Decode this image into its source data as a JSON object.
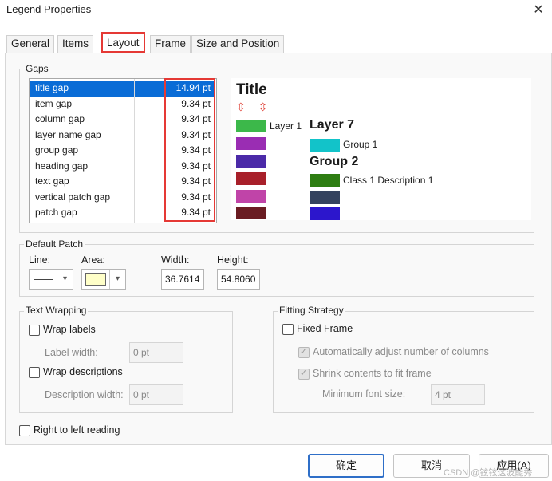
{
  "window": {
    "title": "Legend Properties",
    "close_glyph": "✕"
  },
  "tabs": [
    {
      "label": "General"
    },
    {
      "label": "Items"
    },
    {
      "label": "Layout"
    },
    {
      "label": "Frame"
    },
    {
      "label": "Size and Position"
    }
  ],
  "active_tab": "Layout",
  "gaps": {
    "label": "Gaps",
    "rows": [
      {
        "name": "title gap",
        "value": "14.94 pt",
        "selected": true
      },
      {
        "name": "item gap",
        "value": "9.34 pt"
      },
      {
        "name": "column gap",
        "value": "9.34 pt"
      },
      {
        "name": "layer name gap",
        "value": "9.34 pt"
      },
      {
        "name": "group gap",
        "value": "9.34 pt"
      },
      {
        "name": "heading gap",
        "value": "9.34 pt"
      },
      {
        "name": "text gap",
        "value": "9.34 pt"
      },
      {
        "name": "vertical patch gap",
        "value": "9.34 pt"
      },
      {
        "name": "patch gap",
        "value": "9.34 pt"
      }
    ]
  },
  "preview": {
    "title": "Title",
    "gap_arrows": "⇳ ⇳",
    "layer1_label": "Layer 1",
    "layer7_label": "Layer 7",
    "group1_label": "Group 1",
    "group2_label": "Group 2",
    "class_label": "Class 1 Description 1",
    "colors": {
      "green": "#3cb84a",
      "purple": "#9a2db3",
      "indigo": "#4b2aa8",
      "crimson": "#a8202a",
      "magenta": "#c044a8",
      "maroon": "#6a1c22",
      "cyan": "#12c3c9",
      "darkgreen": "#2e7d12",
      "slate": "#34425e",
      "blue": "#2c16cc",
      "arrow": "#e0463c"
    }
  },
  "default_patch": {
    "label": "Default Patch",
    "line_label": "Line:",
    "area_label": "Area:",
    "width_label": "Width:",
    "height_label": "Height:",
    "width_value": "36.7614",
    "height_value": "54.8060",
    "area_color": "#ffffc8",
    "dropdown_icon": "▾"
  },
  "text_wrapping": {
    "label": "Text Wrapping",
    "wrap_labels": "Wrap labels",
    "label_width_label": "Label width:",
    "label_width_value": "0 pt",
    "wrap_descriptions": "Wrap descriptions",
    "description_width_label": "Description width:",
    "description_width_value": "0 pt"
  },
  "fitting_strategy": {
    "label": "Fitting Strategy",
    "fixed_frame": "Fixed Frame",
    "auto_adjust": "Automatically adjust number of columns",
    "shrink": "Shrink contents to fit frame",
    "min_font_label": "Minimum font size:",
    "min_font_value": "4 pt"
  },
  "right_to_left": "Right to left reading",
  "buttons": {
    "ok": "确定",
    "cancel": "取消",
    "apply": "应用(A)"
  },
  "watermark": "CSDN @铉铉这波能秀"
}
